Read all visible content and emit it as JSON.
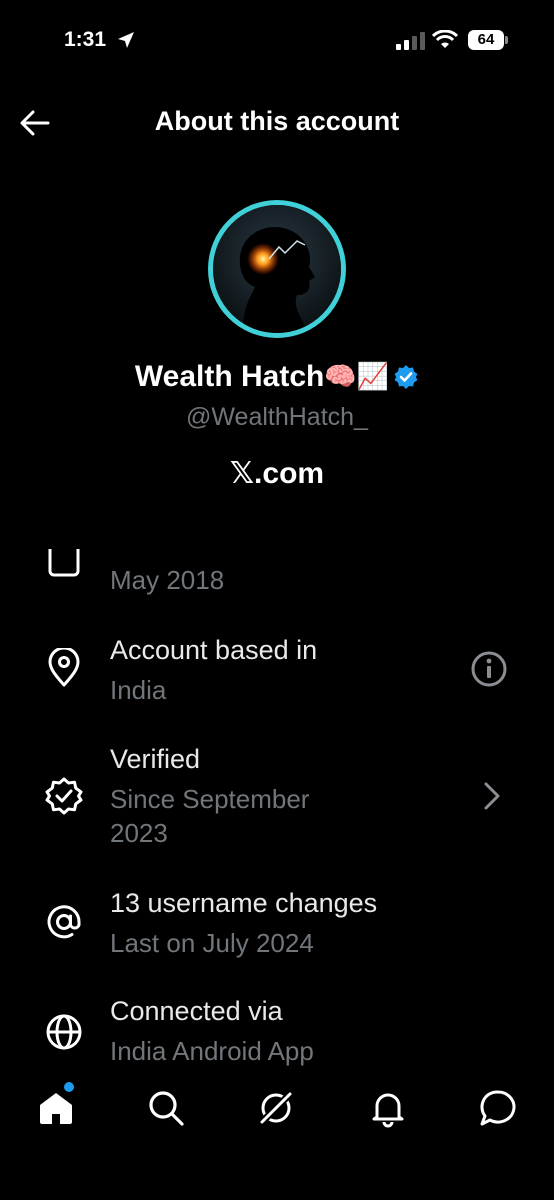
{
  "status_bar": {
    "time": "1:31",
    "battery": "64"
  },
  "header": {
    "title": "About this account"
  },
  "profile": {
    "display_name": "Wealth Hatch",
    "name_emojis": "🧠📈",
    "handle": "@WealthHatch_",
    "platform": "𝕏.com"
  },
  "rows": [
    {
      "title": "",
      "subtitle": "May 2018"
    },
    {
      "title": "Account based in",
      "subtitle": "India"
    },
    {
      "title": "Verified",
      "subtitle": "Since September 2023"
    },
    {
      "title": "13 username changes",
      "subtitle": "Last on July 2024"
    },
    {
      "title": "Connected via",
      "subtitle": "India Android App"
    }
  ],
  "colors": {
    "accent": "#1d9bf0",
    "avatar_ring": "#3fd0d8",
    "muted": "#71767b"
  },
  "icons": [
    "location-arrow-icon",
    "signal-icon",
    "wifi-icon",
    "battery-icon",
    "back-arrow-icon",
    "verified-badge-icon",
    "calendar-icon",
    "location-pin-icon",
    "info-icon",
    "verified-seal-icon",
    "chevron-right-icon",
    "at-sign-icon",
    "globe-icon",
    "home-icon",
    "search-icon",
    "grok-icon",
    "bell-icon",
    "messages-icon"
  ]
}
